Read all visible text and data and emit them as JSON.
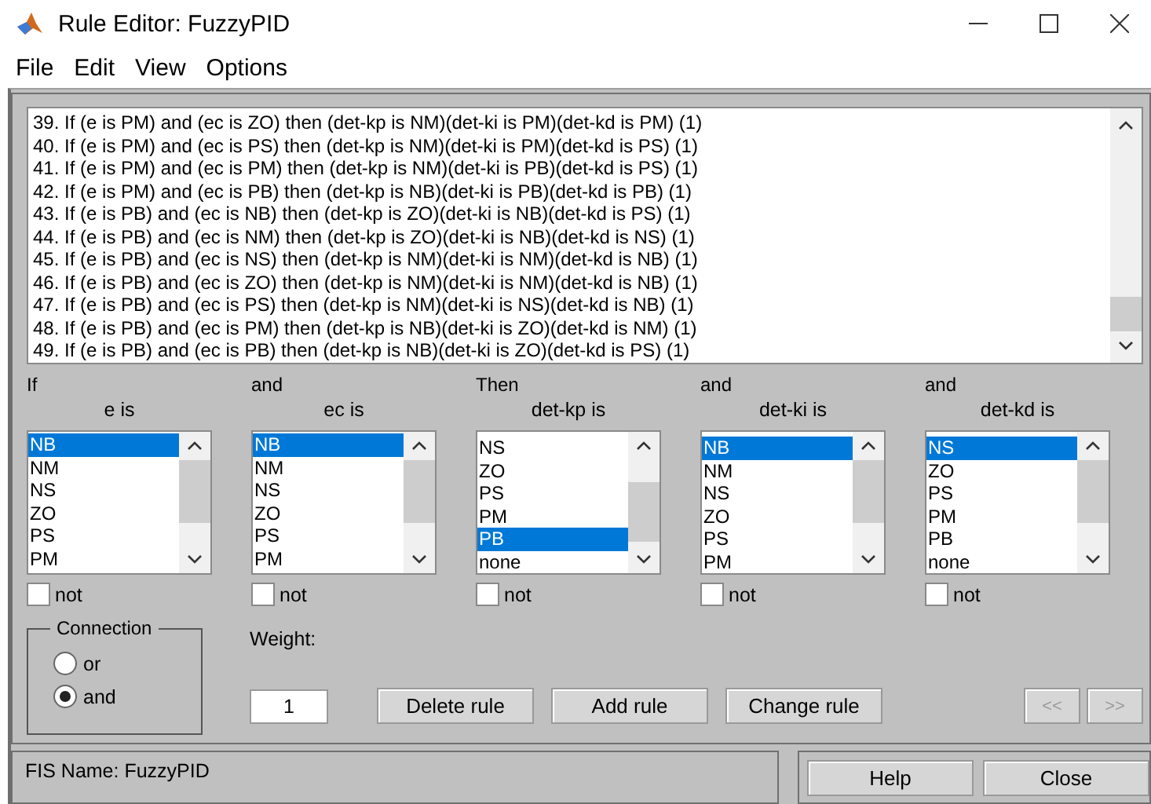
{
  "window": {
    "title": "Rule Editor: FuzzyPID"
  },
  "menu": [
    "File",
    "Edit",
    "View",
    "Options"
  ],
  "rules": [
    "39. If (e is PM) and (ec is ZO) then (det-kp is NM)(det-ki is PM)(det-kd is PM) (1)",
    "40. If (e is PM) and (ec is PS) then (det-kp is NM)(det-ki is PM)(det-kd is PS) (1)",
    "41. If (e is PM) and (ec is PM) then (det-kp is NM)(det-ki is PB)(det-kd is PS) (1)",
    "42. If (e is PM) and (ec is PB) then (det-kp is NB)(det-ki is PB)(det-kd is PB) (1)",
    "43. If (e is PB) and (ec is NB) then (det-kp is ZO)(det-ki is NB)(det-kd is PS) (1)",
    "44. If (e is PB) and (ec is NM) then (det-kp is ZO)(det-ki is NB)(det-kd is NS) (1)",
    "45. If (e is PB) and (ec is NS) then (det-kp is NM)(det-ki is NM)(det-kd is NB) (1)",
    "46. If (e is PB) and (ec is ZO) then (det-kp is NM)(det-ki is NM)(det-kd is NB) (1)",
    "47. If (e is PB) and (ec is PS) then (det-kp is NM)(det-ki is NS)(det-kd is NB) (1)",
    "48. If (e is PB) and (ec is PM) then (det-kp is NB)(det-ki is ZO)(det-kd is NM) (1)",
    "49. If (e is PB) and (ec is PB) then (det-kp is NB)(det-ki is ZO)(det-kd is PS) (1)"
  ],
  "columns": [
    {
      "header": "If",
      "label": "e is",
      "items": [
        {
          "text": "NB",
          "selected": true
        },
        {
          "text": "NM",
          "selected": false
        },
        {
          "text": "NS",
          "selected": false
        },
        {
          "text": "ZO",
          "selected": false
        },
        {
          "text": "PS",
          "selected": false
        },
        {
          "text": "PM",
          "selected": false
        }
      ],
      "not": {
        "label": "not",
        "checked": false
      }
    },
    {
      "header": "and",
      "label": "ec is",
      "items": [
        {
          "text": "NB",
          "selected": true
        },
        {
          "text": "NM",
          "selected": false
        },
        {
          "text": "NS",
          "selected": false
        },
        {
          "text": "ZO",
          "selected": false
        },
        {
          "text": "PS",
          "selected": false
        },
        {
          "text": "PM",
          "selected": false
        }
      ],
      "not": {
        "label": "not",
        "checked": false
      }
    },
    {
      "header": "Then",
      "label": "det-kp is",
      "items": [
        {
          "text": "NS",
          "selected": false
        },
        {
          "text": "ZO",
          "selected": false
        },
        {
          "text": "PS",
          "selected": false
        },
        {
          "text": "PM",
          "selected": false
        },
        {
          "text": "PB",
          "selected": true
        },
        {
          "text": "none",
          "selected": false
        }
      ],
      "not": {
        "label": "not",
        "checked": false
      }
    },
    {
      "header": "and",
      "label": "det-ki is",
      "items": [
        {
          "text": "NB",
          "selected": true
        },
        {
          "text": "NM",
          "selected": false
        },
        {
          "text": "NS",
          "selected": false
        },
        {
          "text": "ZO",
          "selected": false
        },
        {
          "text": "PS",
          "selected": false
        },
        {
          "text": "PM",
          "selected": false
        }
      ],
      "not": {
        "label": "not",
        "checked": false
      }
    },
    {
      "header": "and",
      "label": "det-kd is",
      "items": [
        {
          "text": "NS",
          "selected": true
        },
        {
          "text": "ZO",
          "selected": false
        },
        {
          "text": "PS",
          "selected": false
        },
        {
          "text": "PM",
          "selected": false
        },
        {
          "text": "PB",
          "selected": false
        },
        {
          "text": "none",
          "selected": false
        }
      ],
      "not": {
        "label": "not",
        "checked": false
      }
    }
  ],
  "connection": {
    "title": "Connection",
    "options": [
      {
        "label": "or",
        "selected": false
      },
      {
        "label": "and",
        "selected": true
      }
    ]
  },
  "weight": {
    "label": "Weight:",
    "value": "1"
  },
  "actions": [
    {
      "label": "Delete rule",
      "disabled": false
    },
    {
      "label": "Add rule",
      "disabled": false
    },
    {
      "label": "Change rule",
      "disabled": false
    }
  ],
  "nav": [
    {
      "label": "<<",
      "disabled": true
    },
    {
      "label": ">>",
      "disabled": true
    }
  ],
  "status": "FIS Name: FuzzyPID",
  "footer_buttons": [
    {
      "label": "Help",
      "disabled": false
    },
    {
      "label": "Close",
      "disabled": false
    }
  ]
}
